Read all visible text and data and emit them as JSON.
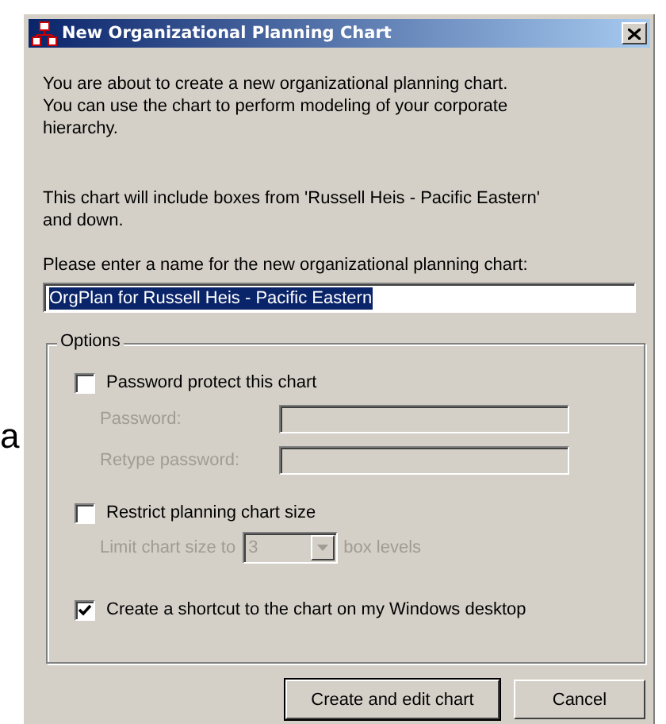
{
  "background_text": "a",
  "window": {
    "title": "New Organizational Planning Chart"
  },
  "intro": {
    "lines": [
      "You are about to create a new organizational planning chart.",
      "You can use the chart to perform modeling of your corporate",
      "hierarchy."
    ]
  },
  "scope": {
    "lines": [
      "This chart will include boxes from 'Russell Heis - Pacific Eastern'",
      "and down."
    ]
  },
  "name_prompt": "Please enter a name for the new organizational planning chart:",
  "name_field": {
    "value": "OrgPlan for Russell Heis - Pacific Eastern",
    "selected": true
  },
  "options": {
    "title": "Options",
    "items": [
      {
        "kind": "checkbox",
        "label": "Password protect this chart",
        "checked": false
      },
      {
        "kind": "field",
        "label": "Password:",
        "disabled": true
      },
      {
        "kind": "field",
        "label": "Retype password:",
        "disabled": true
      },
      {
        "kind": "checkbox",
        "label": "Restrict planning chart size",
        "checked": false
      },
      {
        "kind": "combo",
        "label": "Limit chart size to",
        "value": "3",
        "suffix": "box levels",
        "disabled": true
      },
      {
        "kind": "checkbox",
        "label": "Create a shortcut to the chart on my Windows desktop",
        "checked": true
      }
    ]
  },
  "buttons": [
    {
      "label": "Create and edit chart",
      "default": true
    },
    {
      "label": "Cancel",
      "default": false
    }
  ]
}
